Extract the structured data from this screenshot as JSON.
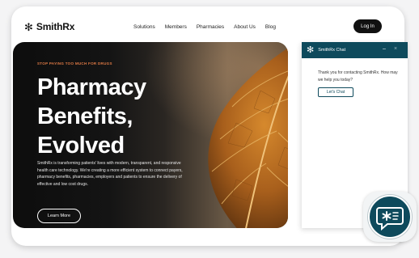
{
  "brand": {
    "name": "SmithRx",
    "logo_icon": "snowflake-icon"
  },
  "nav": {
    "items": [
      {
        "label": "Solutions"
      },
      {
        "label": "Members"
      },
      {
        "label": "Pharmacies"
      },
      {
        "label": "About Us"
      },
      {
        "label": "Blog"
      }
    ],
    "login_label": "Log In"
  },
  "hero": {
    "eyebrow": "STOP PAYING TOO MUCH FOR DRUGS",
    "headline": [
      "Pharmacy",
      "Benefits,",
      "Evolved"
    ],
    "body": "SmithRx is transforming patients' lives with modern, transparent, and responsive health care technology. We're creating a more efficient system to connect payers, pharmacy benefits, pharmacies, employers and patients to ensure the delivery of effective and low cost drugs.",
    "cta_label": "Learn More"
  },
  "chat": {
    "title": "SmithRx Chat",
    "minimize": "–",
    "close": "×",
    "message": "Thank you for contacting SmithRx. How may we help you today?",
    "button_label": "Let's Chat"
  },
  "colors": {
    "accent_orange": "#e07a45",
    "chat_teal": "#0e4a5c",
    "dark": "#111111"
  }
}
